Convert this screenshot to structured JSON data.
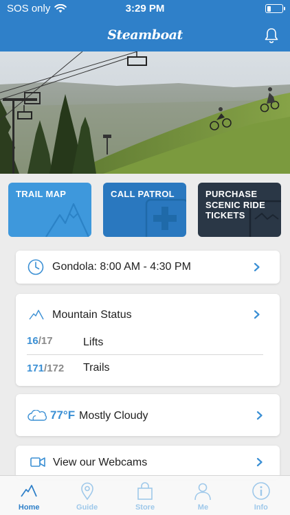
{
  "status_bar": {
    "carrier": "SOS only",
    "time": "3:29 PM",
    "battery_level": 0.25
  },
  "header": {
    "logo_text": "Steamboat",
    "bell_icon": "bell-icon",
    "brand_color": "#2f80c9"
  },
  "tiles": [
    {
      "label": "TRAIL MAP",
      "icon": "mountain-icon",
      "color": "#3e98dc"
    },
    {
      "label": "CALL PATROL",
      "icon": "plus-cross-icon",
      "color": "#2a78bf"
    },
    {
      "label": "PURCHASE SCENIC RIDE TICKETS",
      "icon": "ticket-icon",
      "color": "#2a3746"
    }
  ],
  "gondola": {
    "text": "Gondola: 8:00 AM - 4:30 PM",
    "icon": "clock-icon"
  },
  "mountain_status": {
    "title": "Mountain Status",
    "icon": "mountain-icon",
    "lifts": {
      "open": "16",
      "total": "/17",
      "label": "Lifts"
    },
    "trails": {
      "open": "171",
      "total": "/172",
      "label": "Trails"
    }
  },
  "weather": {
    "temp": "77°F",
    "condition": "Mostly Cloudy",
    "icon": "cloud-icon"
  },
  "webcams": {
    "text": "View our Webcams",
    "icon": "video-camera-icon"
  },
  "tabbar": [
    {
      "label": "Home",
      "icon": "mountain-icon",
      "active": true
    },
    {
      "label": "Guide",
      "icon": "map-pin-icon",
      "active": false
    },
    {
      "label": "Store",
      "icon": "shopping-bag-icon",
      "active": false
    },
    {
      "label": "Me",
      "icon": "person-icon",
      "active": false
    },
    {
      "label": "Info",
      "icon": "info-icon",
      "active": false
    }
  ]
}
